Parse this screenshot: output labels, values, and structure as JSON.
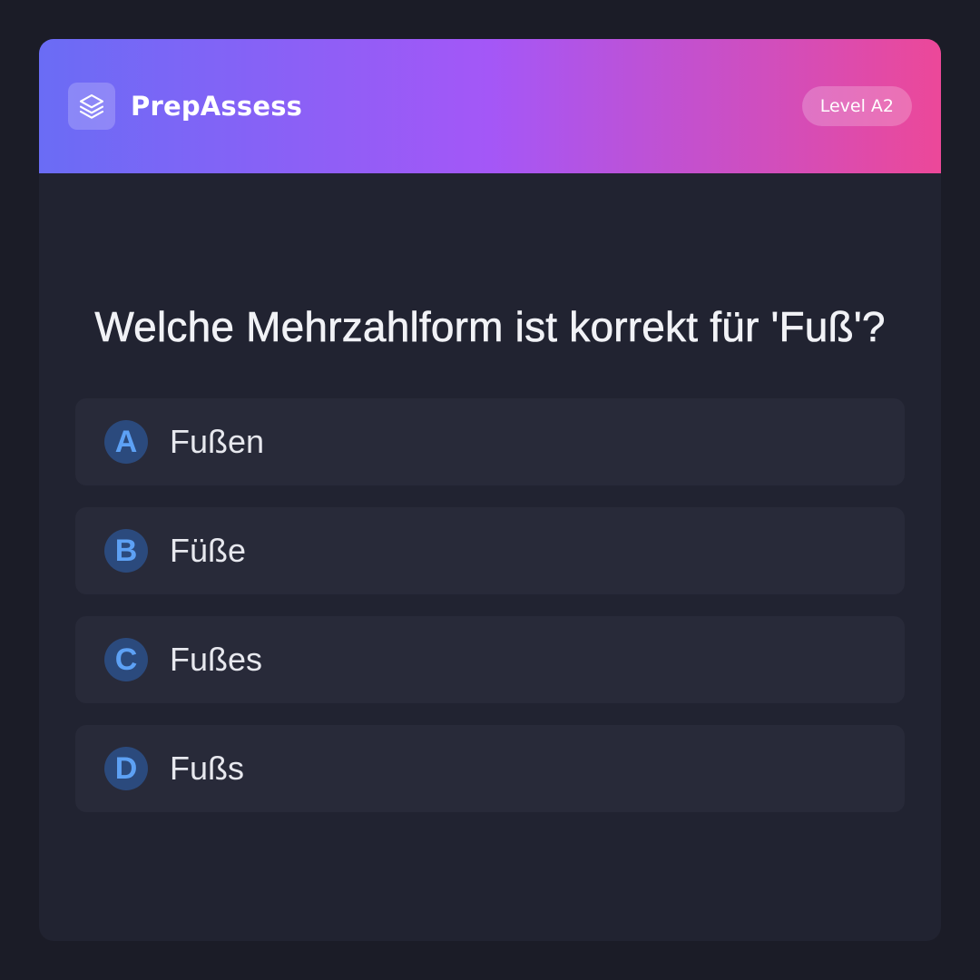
{
  "header": {
    "brand_name": "PrepAssess",
    "logo_icon": "layers-icon",
    "level_badge": "Level A2",
    "gradient_colors": [
      "#6a6cf5",
      "#a457f7",
      "#ec4899"
    ]
  },
  "question": {
    "text": "Welche Mehrzahlform ist korrekt für 'Fuß'?"
  },
  "options": [
    {
      "letter": "A",
      "text": "Fußen"
    },
    {
      "letter": "B",
      "text": "Füße"
    },
    {
      "letter": "C",
      "text": "Fußes"
    },
    {
      "letter": "D",
      "text": "Fußs"
    }
  ],
  "colors": {
    "background": "#1b1c27",
    "card": "#212331",
    "option_bg": "#282a39",
    "letter_bg": "#2b4a7d",
    "letter_fg": "#5da1f5"
  }
}
